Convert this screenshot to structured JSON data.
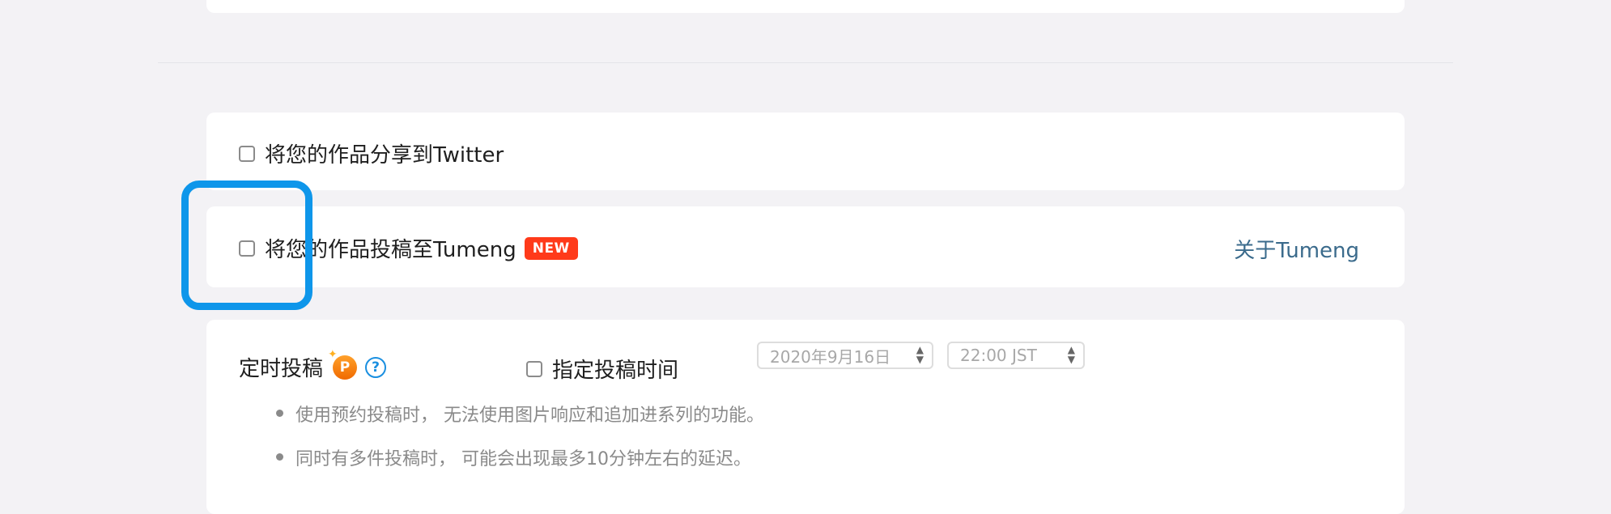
{
  "twitter": {
    "label": "将您的作品分享到Twitter"
  },
  "tumeng": {
    "label": "将您的作品投稿至Tumeng",
    "badge": "NEW",
    "about_link": "关于Tumeng"
  },
  "schedule": {
    "title": "定时投稿",
    "premium_icon_letter": "P",
    "help_icon_symbol": "?",
    "specify_time_label": "指定投稿时间",
    "date_value": "2020年9月16日",
    "time_value": "22:00 JST",
    "notes": [
      "使用预约投稿时， 无法使用图片响应和追加进系列的功能。",
      "同时有多件投稿时， 可能会出现最多10分钟左右的延迟。"
    ]
  },
  "colors": {
    "highlight": "#0e96ea",
    "badge": "#ff3a1a",
    "link": "#3b6b8c",
    "help": "#1a8fe0"
  }
}
